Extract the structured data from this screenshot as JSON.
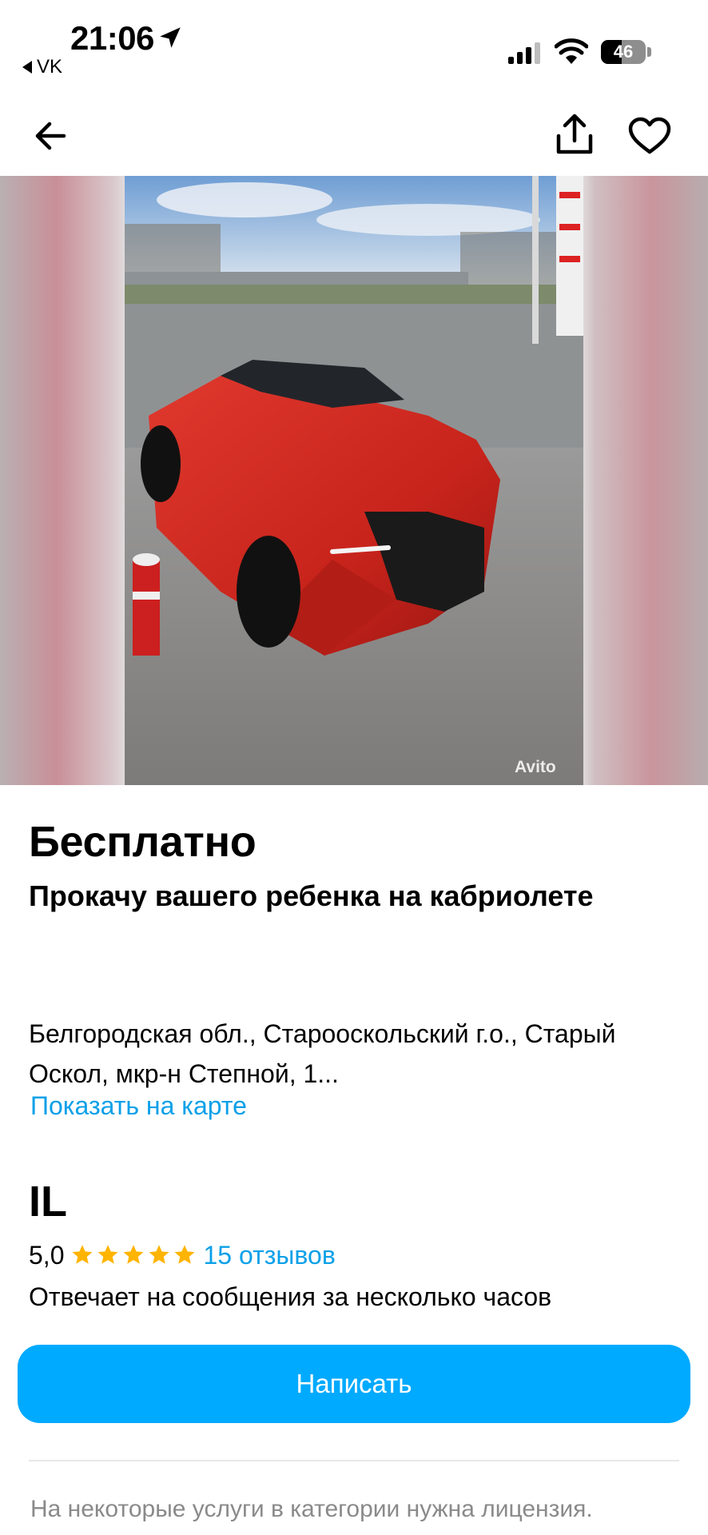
{
  "status_bar": {
    "time": "21:06",
    "back_app": "VK",
    "battery": "46"
  },
  "nav": {
    "back_icon": "arrow-left-icon",
    "share_icon": "share-icon",
    "favorite_icon": "heart-icon"
  },
  "gallery": {
    "watermark": "Avito"
  },
  "listing": {
    "price": "Бесплатно",
    "title": "Прокачу вашего ребенка на кабриолете",
    "address": "Белгородская обл., Старооскольский г.о., Старый Оскол, мкр-н Степной, 1...",
    "map_link": "Показать на карте"
  },
  "seller": {
    "name": "IL",
    "rating": "5,0",
    "stars": 5,
    "reviews": "15 отзывов",
    "response_time": "Отвечает на сообщения за несколько часов"
  },
  "actions": {
    "write": "Написать"
  },
  "footer": {
    "license_note": "На некоторые услуги в категории нужна лицензия."
  },
  "colors": {
    "accent": "#00aaff",
    "link": "#0aa0e8",
    "star": "#ffb400"
  }
}
